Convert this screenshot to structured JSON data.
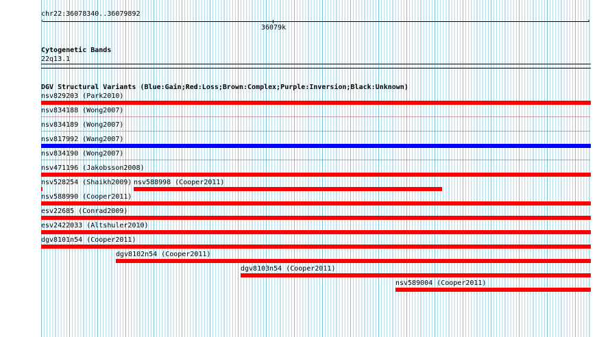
{
  "ruler": {
    "region": "chr22:36078340..36079892",
    "tick_label": "36079k"
  },
  "cytoband": {
    "title": "Cytogenetic Bands",
    "band": "22q13.1"
  },
  "dgv": {
    "title": "DGV Structural Variants (Blue:Gain;Red:Loss;Brown:Complex;Purple:Inversion;Black:Unknown)",
    "colors": {
      "loss": "#ff0000",
      "gain": "#0000ff"
    },
    "tracks": [
      {
        "label": "nsv829203 (Park2010)",
        "type": "loss"
      },
      {
        "label": "nsv834188 (Wong2007)",
        "type": "loss"
      },
      {
        "label": "nsv834189 (Wong2007)",
        "type": "loss"
      },
      {
        "label": "nsv817992 (Wang2007)",
        "type": "gain"
      },
      {
        "label": "nsv834190 (Wong2007)",
        "type": "loss"
      },
      {
        "label": "nsv471196 (Jakobsson2008)",
        "type": "loss"
      },
      {
        "label": "nsv528254 (Shaikh2009)",
        "type": "loss"
      },
      {
        "label": "nsv588998 (Cooper2011)",
        "type": "loss"
      },
      {
        "label": "nsv588990 (Cooper2011)",
        "type": "loss"
      },
      {
        "label": "esv22685 (Conrad2009)",
        "type": "loss"
      },
      {
        "label": "esv2422033 (Altshuler2010)",
        "type": "loss"
      },
      {
        "label": "dgv8101n54 (Cooper2011)",
        "type": "loss"
      },
      {
        "label": "dgv8102n54 (Cooper2011)",
        "type": "loss"
      },
      {
        "label": "dgv8103n54 (Cooper2011)",
        "type": "loss"
      },
      {
        "label": "nsv589004 (Cooper2011)",
        "type": "loss"
      }
    ]
  }
}
